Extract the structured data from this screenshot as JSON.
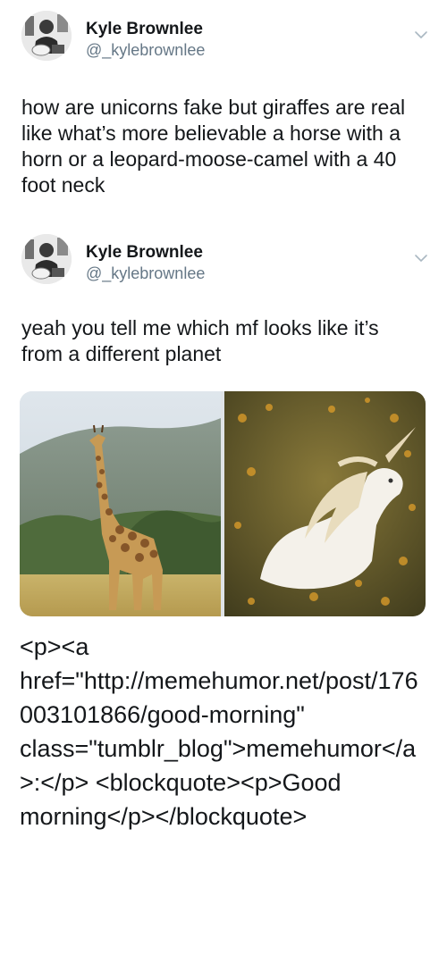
{
  "tweets": [
    {
      "display_name": "Kyle Brownlee",
      "handle": "@_kylebrownlee",
      "text": "how are unicorns fake but giraffes are real like what’s more believable a horse with a horn or a leopard-moose-camel with a 40 foot neck"
    },
    {
      "display_name": "Kyle Brownlee",
      "handle": "@_kylebrownlee",
      "text": "yeah you tell me which mf looks like it’s from a different planet",
      "media": [
        {
          "icon": "giraffe-photo"
        },
        {
          "icon": "unicorn-photo"
        }
      ]
    }
  ],
  "caption": "<p><a href=\"http://memehumor.net/post/176003101866/good-morning\" class=\"tumblr_blog\">memehumor</a>:</p> <blockquote><p>Good morning</p></blockquote>",
  "colors": {
    "text": "#14171a",
    "secondary": "#657786",
    "chevron": "#aab8c2"
  }
}
